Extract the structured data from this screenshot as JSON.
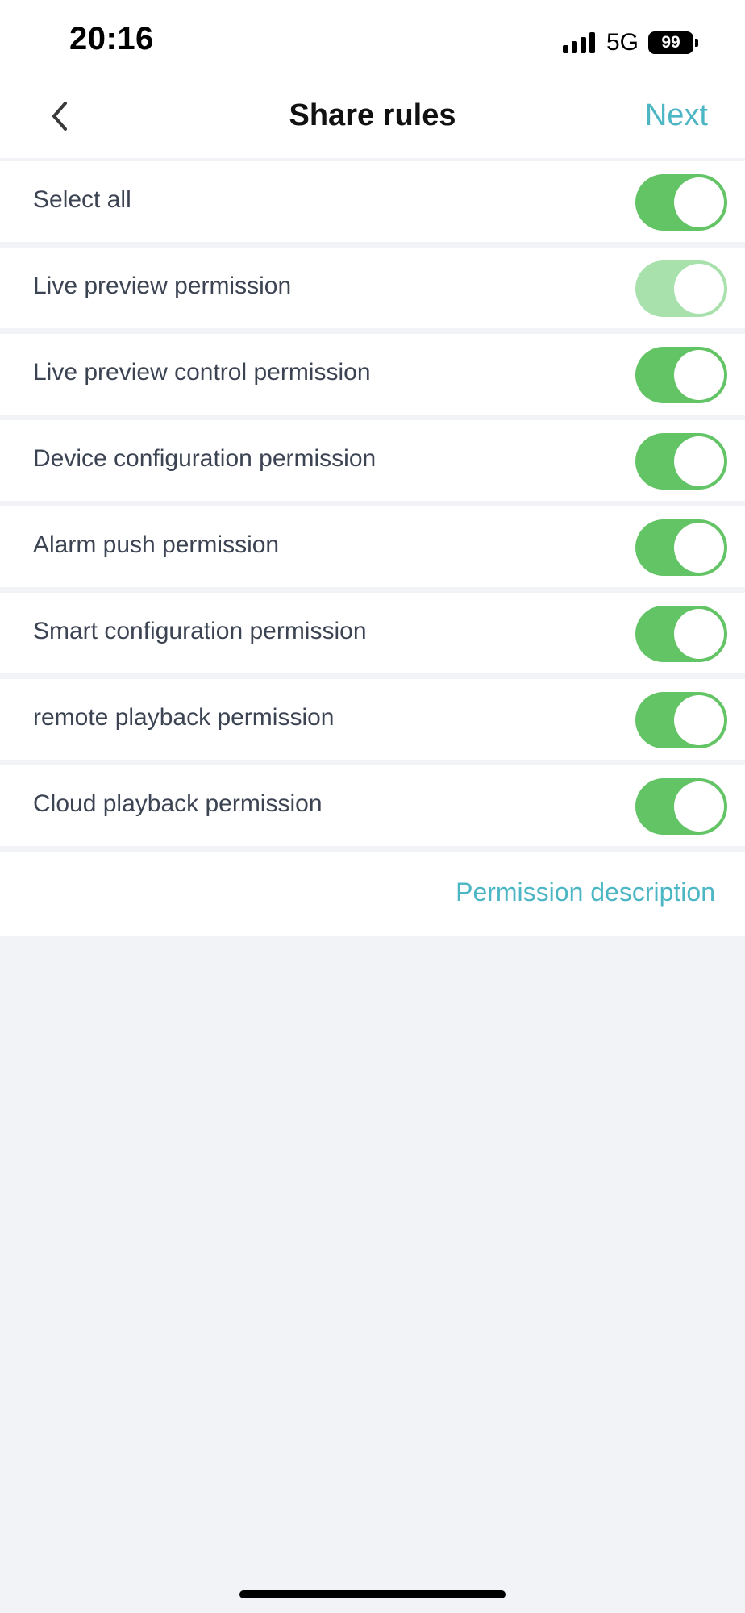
{
  "status_bar": {
    "time": "20:16",
    "network": "5G",
    "battery": "99"
  },
  "nav": {
    "back_icon": "chevron-left-icon",
    "title": "Share rules",
    "next_label": "Next"
  },
  "permissions": [
    {
      "label": "Select all",
      "enabled": true
    },
    {
      "label": "Live preview permission",
      "enabled": true,
      "disabled": true
    },
    {
      "label": "Live preview control permission",
      "enabled": true
    },
    {
      "label": "Device configuration permission",
      "enabled": true
    },
    {
      "label": "Alarm push permission",
      "enabled": true
    },
    {
      "label": "Smart configuration permission",
      "enabled": true
    },
    {
      "label": "remote playback permission",
      "enabled": true
    },
    {
      "label": "Cloud playback permission",
      "enabled": true
    }
  ],
  "footer": {
    "link_label": "Permission description"
  },
  "colors": {
    "accent": "#4db6c4",
    "toggle_on": "#63c466",
    "toggle_disabled": "#a9e1ad",
    "background": "#f2f3f7"
  }
}
